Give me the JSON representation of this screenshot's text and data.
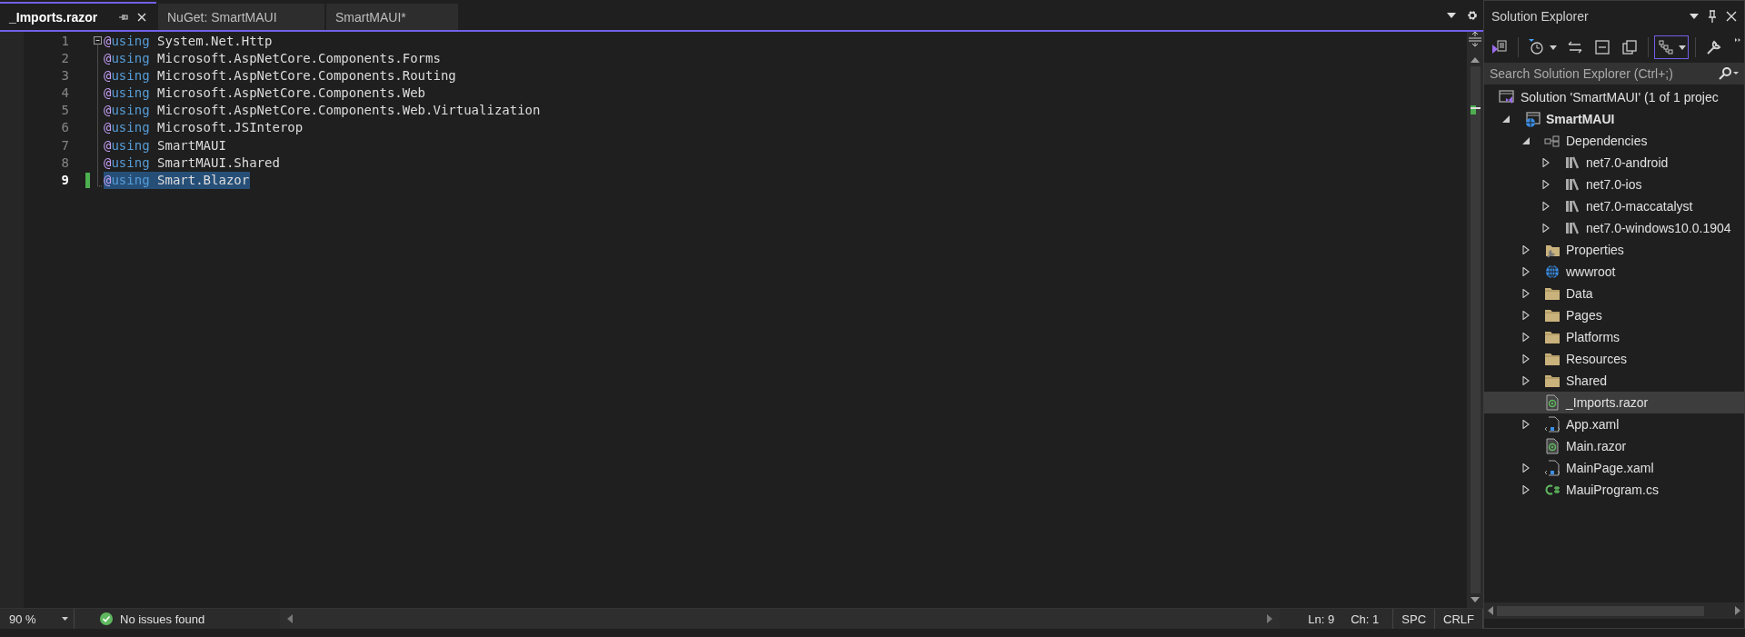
{
  "tabs": [
    {
      "label": "_Imports.razor",
      "selected": true
    },
    {
      "label": "NuGet: SmartMAUI",
      "selected": false
    },
    {
      "label": "SmartMAUI*",
      "selected": false
    }
  ],
  "editor": {
    "lines": [
      {
        "number": "1",
        "directive": "@using",
        "value": "System.Net.Http",
        "current": false,
        "modified": false,
        "selected": false
      },
      {
        "number": "2",
        "directive": "@using",
        "value": "Microsoft.AspNetCore.Components.Forms",
        "current": false,
        "modified": false,
        "selected": false
      },
      {
        "number": "3",
        "directive": "@using",
        "value": "Microsoft.AspNetCore.Components.Routing",
        "current": false,
        "modified": false,
        "selected": false
      },
      {
        "number": "4",
        "directive": "@using",
        "value": "Microsoft.AspNetCore.Components.Web",
        "current": false,
        "modified": false,
        "selected": false
      },
      {
        "number": "5",
        "directive": "@using",
        "value": "Microsoft.AspNetCore.Components.Web.Virtualization",
        "current": false,
        "modified": false,
        "selected": false
      },
      {
        "number": "6",
        "directive": "@using",
        "value": "Microsoft.JSInterop",
        "current": false,
        "modified": false,
        "selected": false
      },
      {
        "number": "7",
        "directive": "@using",
        "value": "SmartMAUI",
        "current": false,
        "modified": false,
        "selected": false
      },
      {
        "number": "8",
        "directive": "@using",
        "value": "SmartMAUI.Shared",
        "current": false,
        "modified": false,
        "selected": false
      },
      {
        "number": "9",
        "directive": "@using",
        "value": "Smart.Blazor",
        "current": true,
        "modified": true,
        "selected": true
      }
    ]
  },
  "status_bar": {
    "zoom": "90 %",
    "issues": "No issues found",
    "line": "Ln: 9",
    "column": "Ch: 1",
    "whitespace": "SPC",
    "line_ending": "CRLF"
  },
  "solution_explorer": {
    "title": "Solution Explorer",
    "toolbar": [
      {
        "kind": "home",
        "on": false
      },
      {
        "kind": "history",
        "on": false
      },
      {
        "kind": "sync",
        "on": false
      },
      {
        "kind": "collapse",
        "on": false
      },
      {
        "kind": "copy",
        "on": false
      },
      {
        "kind": "tree",
        "on": true
      },
      {
        "kind": "properties",
        "on": false
      }
    ],
    "search": {
      "placeholder": "Search Solution Explorer (Ctrl+;)"
    },
    "tree": [
      {
        "label": "Solution 'SmartMAUI' (1 of 1 projec",
        "kind": "solution",
        "selected": false,
        "children": [
          {
            "label": "SmartMAUI",
            "kind": "project",
            "startup": true,
            "selected": false,
            "expanded": true,
            "children": [
              {
                "label": "Dependencies",
                "kind": "dependencies",
                "selected": false,
                "expanded": true,
                "children": [
                  {
                    "label": "net7.0-android",
                    "kind": "framework",
                    "selected": false,
                    "expanded": false
                  },
                  {
                    "label": "net7.0-ios",
                    "kind": "framework",
                    "selected": false,
                    "expanded": false
                  },
                  {
                    "label": "net7.0-maccatalyst",
                    "kind": "framework",
                    "selected": false,
                    "expanded": false
                  },
                  {
                    "label": "net7.0-windows10.0.1904",
                    "kind": "framework",
                    "selected": false,
                    "expanded": false
                  }
                ]
              },
              {
                "label": "Properties",
                "kind": "properties",
                "selected": false,
                "expanded": false
              },
              {
                "label": "wwwroot",
                "kind": "web",
                "selected": false,
                "expanded": false
              },
              {
                "label": "Data",
                "kind": "folder",
                "selected": false,
                "expanded": false
              },
              {
                "label": "Pages",
                "kind": "folder",
                "selected": false,
                "expanded": false
              },
              {
                "label": "Platforms",
                "kind": "folder",
                "selected": false,
                "expanded": false
              },
              {
                "label": "Resources",
                "kind": "folder",
                "selected": false,
                "expanded": false
              },
              {
                "label": "Shared",
                "kind": "folder",
                "selected": false,
                "expanded": false
              },
              {
                "label": "_Imports.razor",
                "kind": "razor",
                "selected": true
              },
              {
                "label": "App.xaml",
                "kind": "xaml",
                "selected": false,
                "expanded": false
              },
              {
                "label": "Main.razor",
                "kind": "razor",
                "selected": false
              },
              {
                "label": "MainPage.xaml",
                "kind": "xaml",
                "selected": false,
                "expanded": false
              },
              {
                "label": "MauiProgram.cs",
                "kind": "csharp",
                "selected": false,
                "expanded": false
              }
            ]
          }
        ]
      }
    ]
  }
}
